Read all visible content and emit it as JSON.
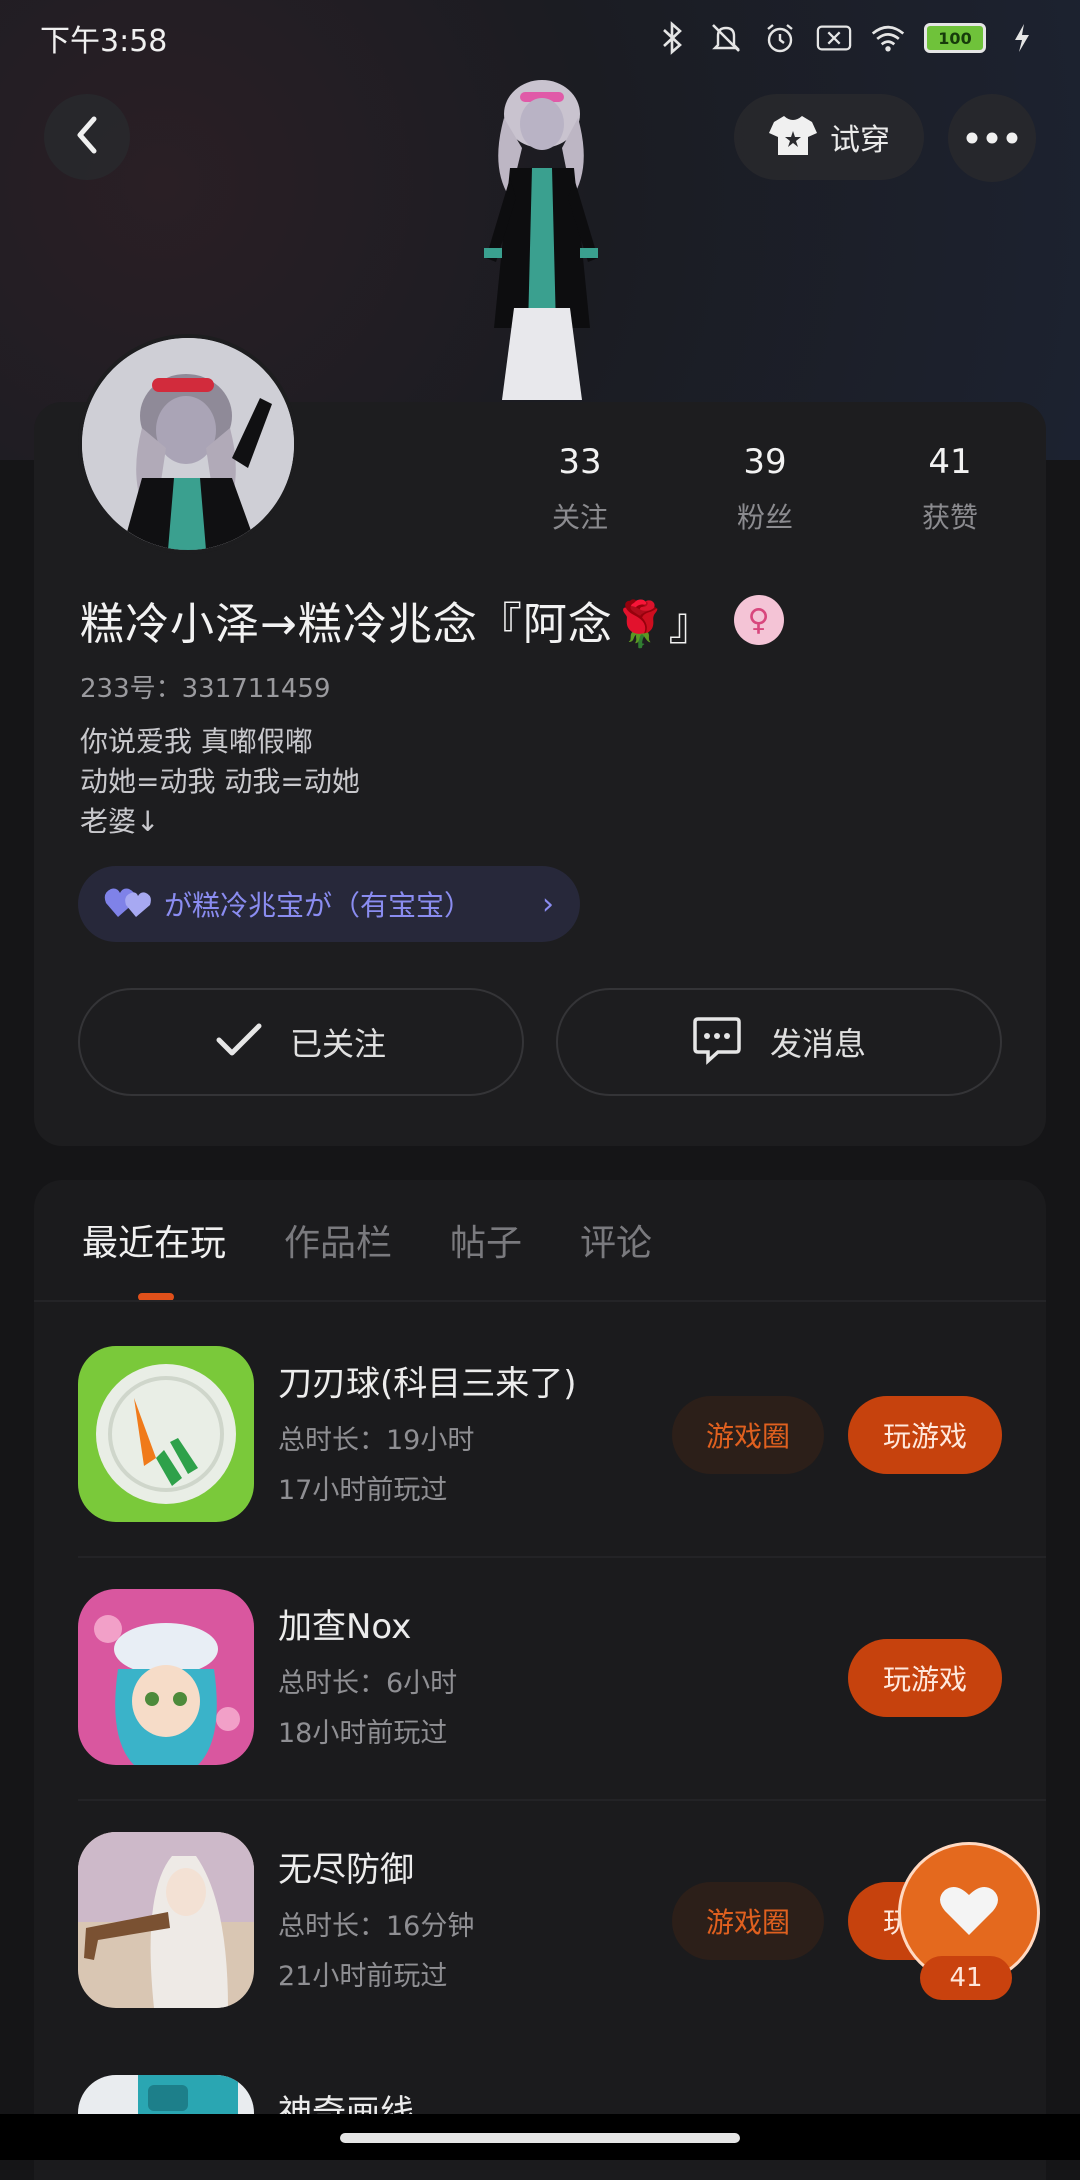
{
  "status_bar": {
    "time": "下午3:58",
    "battery": "100"
  },
  "header": {
    "tryon_label": "试穿"
  },
  "profile": {
    "stats": [
      {
        "value": "33",
        "label": "关注"
      },
      {
        "value": "39",
        "label": "粉丝"
      },
      {
        "value": "41",
        "label": "获赞"
      }
    ],
    "username": "糕冷小泽→糕冷兆念『阿念🌹』",
    "gender_symbol": "♀",
    "uid": "233号：331711459",
    "bio_lines": [
      "你说爱我 真嘟假嘟",
      "动她=动我 动我=动她",
      "老婆↓"
    ],
    "family": "が糕冷兆宝が（有宝宝）",
    "follow_label": "已关注",
    "message_label": "发消息"
  },
  "tabs": [
    "最近在玩",
    "作品栏",
    "帖子",
    "评论"
  ],
  "games": [
    {
      "name": "刀刃球(科目三来了)",
      "duration": "总时长：19小时",
      "last_played": "17小时前玩过",
      "circle_label": "游戏圈",
      "play_label": "玩游戏"
    },
    {
      "name": "加查Nox",
      "duration": "总时长：6小时",
      "last_played": "18小时前玩过",
      "play_label": "玩游戏"
    },
    {
      "name": "无尽防御",
      "duration": "总时长：16分钟",
      "last_played": "21小时前玩过",
      "circle_label": "游戏圈",
      "play_label": "玩游戏"
    },
    {
      "name": "神奇画线"
    }
  ],
  "like_fab": {
    "count": "41"
  },
  "colors": {
    "accent": "#c6420d",
    "family_text": "#8a8cf0",
    "gender_bg": "#f4c4d6"
  }
}
